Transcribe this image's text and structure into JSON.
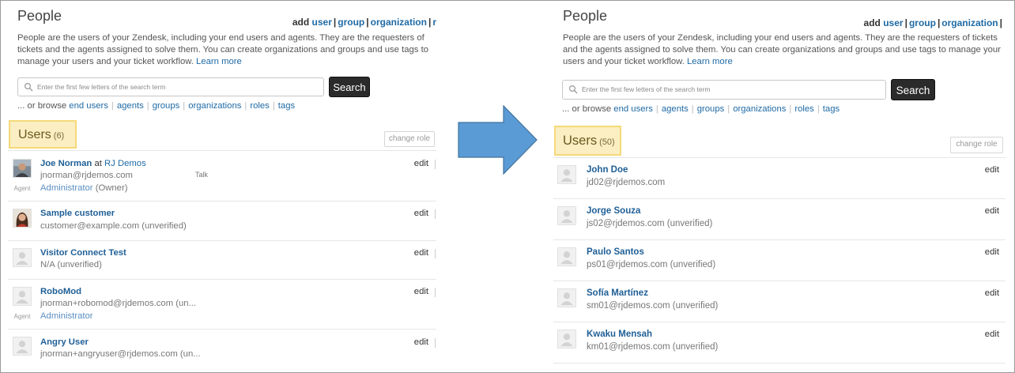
{
  "before": {
    "title": "People",
    "add_links": {
      "prefix": "add",
      "user": "user",
      "group": "group",
      "organization": "organization",
      "more": "r"
    },
    "description": "People are the users of your Zendesk, including your end users and agents. They are the requesters of tickets and the agents assigned to solve them. You can create organizations and groups and use tags to manage your users and your ticket workflow.",
    "learn_more": "Learn more",
    "search": {
      "placeholder": "Enter the first few letters of the search term",
      "button": "Search"
    },
    "browse": {
      "prefix": "... or browse",
      "links": [
        "end users",
        "agents",
        "groups",
        "organizations",
        "roles",
        "tags"
      ]
    },
    "users_heading": "Users",
    "users_count": "(6)",
    "change_role": "change role",
    "users": [
      {
        "name": "Joe Norman",
        "at": "at",
        "org": "RJ Demos",
        "email": "jnorman@rjdemos.com",
        "role": "Administrator",
        "role_note": "(Owner)",
        "tag": "Agent",
        "extra": "Talk",
        "edit": "edit",
        "avatar": "photo-man-icon"
      },
      {
        "name": "Sample customer",
        "email": "customer@example.com (unverified)",
        "edit": "edit",
        "avatar": "photo-woman-icon"
      },
      {
        "name": "Visitor Connect Test",
        "email": "N/A (unverified)",
        "edit": "edit",
        "avatar": "default-avatar-icon"
      },
      {
        "name": "RoboMod",
        "email": "jnorman+robomod@rjdemos.com (un...",
        "role": "Administrator",
        "tag": "Agent",
        "edit": "edit",
        "avatar": "default-avatar-icon"
      },
      {
        "name": "Angry User",
        "email": "jnorman+angryuser@rjdemos.com (un...",
        "edit": "edit",
        "avatar": "default-avatar-icon"
      }
    ]
  },
  "after": {
    "title": "People",
    "add_links": {
      "prefix": "add",
      "user": "user",
      "group": "group",
      "organization": "organization",
      "more": ""
    },
    "description": "People are the users of your Zendesk, including your end users and agents. They are the requesters of tickets and the agents assigned to solve them. You can create organizations and groups and use tags to manage your users and your ticket workflow.",
    "learn_more": "Learn more",
    "search": {
      "placeholder": "Enter the first few letters of the search term",
      "button": "Search"
    },
    "browse": {
      "prefix": "... or browse",
      "links": [
        "end users",
        "agents",
        "groups",
        "organizations",
        "roles",
        "tags"
      ]
    },
    "users_heading": "Users",
    "users_count": "(50)",
    "change_role": "change role",
    "users": [
      {
        "name": "John Doe",
        "email": "jd02@rjdemos.com",
        "edit": "edit",
        "avatar": "default-avatar-icon"
      },
      {
        "name": "Jorge Souza",
        "email": "js02@rjdemos.com (unverified)",
        "edit": "edit",
        "avatar": "default-avatar-icon"
      },
      {
        "name": "Paulo Santos",
        "email": "ps01@rjdemos.com (unverified)",
        "edit": "edit",
        "avatar": "default-avatar-icon"
      },
      {
        "name": "Sofía Martínez",
        "email": "sm01@rjdemos.com (unverified)",
        "edit": "edit",
        "avatar": "default-avatar-icon"
      },
      {
        "name": "Kwaku Mensah",
        "email": "km01@rjdemos.com (unverified)",
        "edit": "edit",
        "avatar": "default-avatar-icon"
      }
    ]
  },
  "colors": {
    "link": "#1f6aa5",
    "highlight_fill": "#fbeec2",
    "highlight_border": "#f5d979",
    "arrow": "#5b9bd5",
    "button": "#2b2b2b"
  },
  "arrow_icon": "right-arrow-icon"
}
